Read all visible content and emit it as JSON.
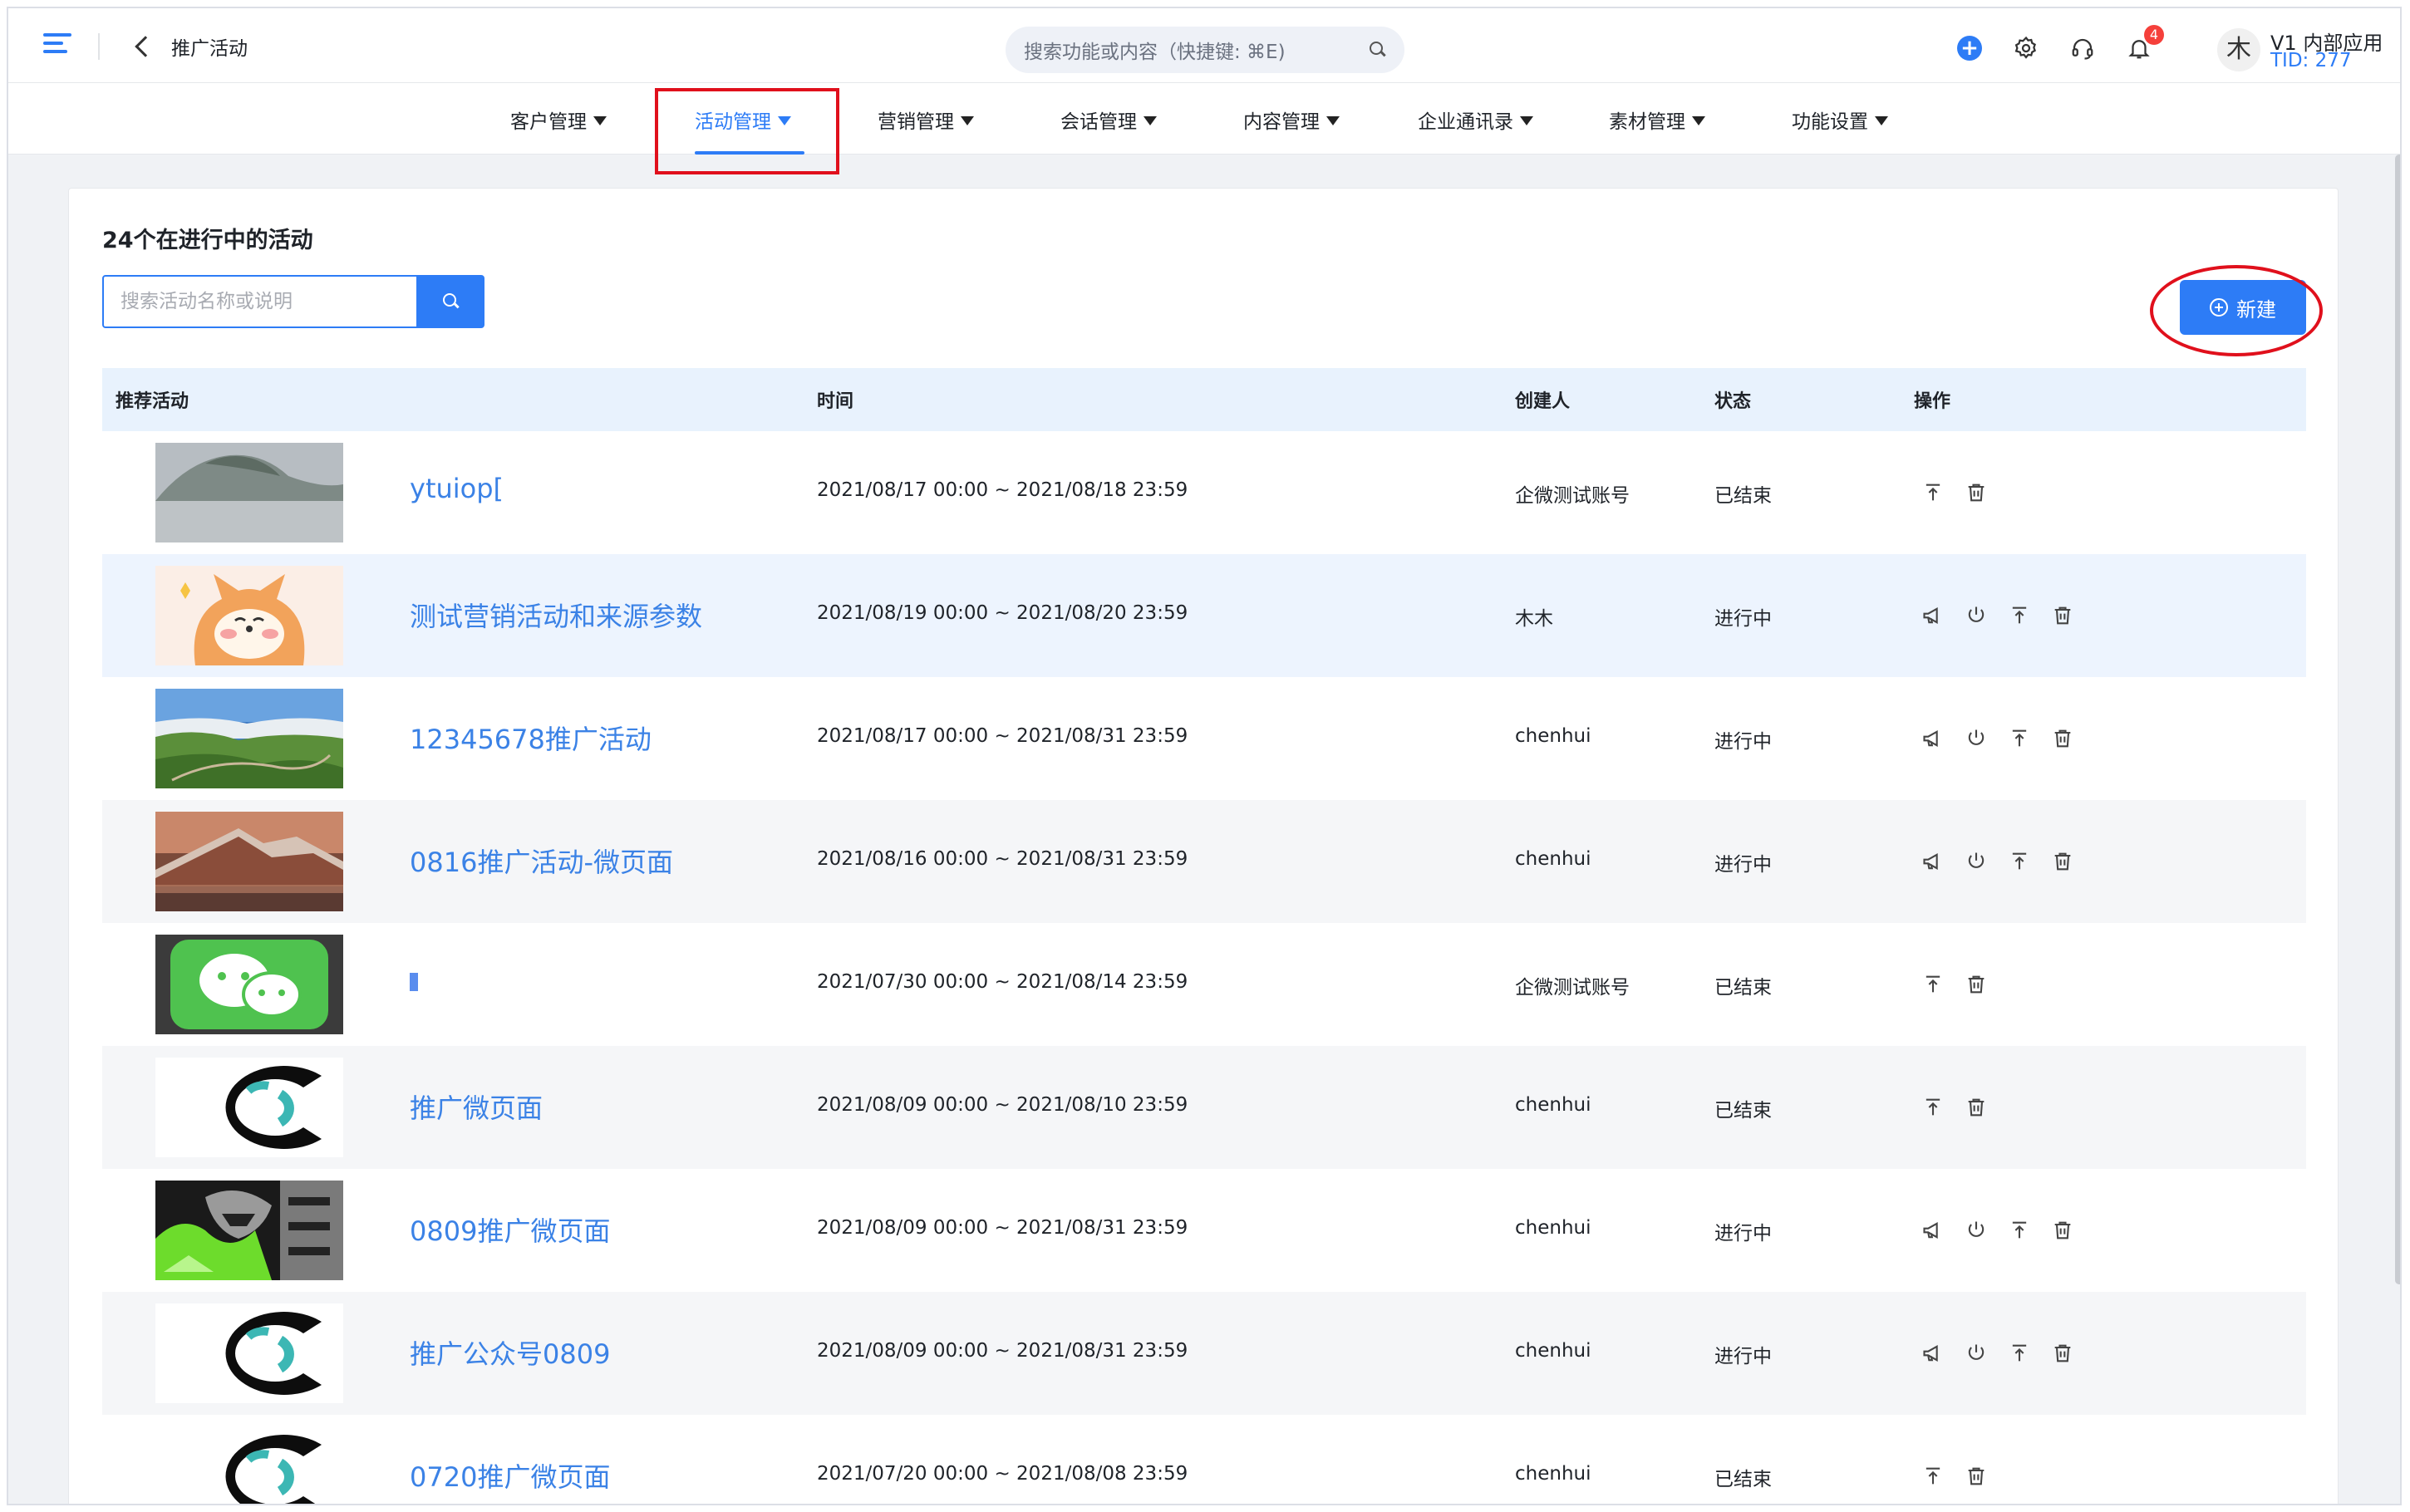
{
  "header": {
    "title": "推广活动",
    "search_placeholder": "搜索功能或内容（快捷键: ⌘E)",
    "notification_count": "4",
    "avatar_text": "木",
    "tenant_name": "V1 内部应用",
    "tenant_tid": "TID: 277"
  },
  "nav": {
    "items": [
      {
        "label": "客户管理"
      },
      {
        "label": "活动管理",
        "active": true
      },
      {
        "label": "营销管理"
      },
      {
        "label": "会话管理"
      },
      {
        "label": "内容管理"
      },
      {
        "label": "企业通讯录"
      },
      {
        "label": "素材管理"
      },
      {
        "label": "功能设置"
      }
    ]
  },
  "main": {
    "heading": "24个在进行中的活动",
    "search_placeholder": "搜索活动名称或说明",
    "new_button_label": "新建",
    "columns": [
      "推荐活动",
      "时间",
      "创建人",
      "状态",
      "操作"
    ],
    "rows": [
      {
        "name": "ytuiop[",
        "time": "2021/08/17 00:00 ~ 2021/08/18 23:59",
        "creator": "企微测试账号",
        "status": "已结束",
        "thumb": "mountain-fog"
      },
      {
        "name": "测试营销活动和来源参数",
        "time": "2021/08/19 00:00 ~ 2021/08/20 23:59",
        "creator": "木木",
        "status": "进行中",
        "thumb": "shiba-cartoon"
      },
      {
        "name": "12345678推广活动",
        "time": "2021/08/17 00:00 ~ 2021/08/31 23:59",
        "creator": "chenhui",
        "status": "进行中",
        "thumb": "green-valley"
      },
      {
        "name": "0816推广活动-微页面",
        "time": "2021/08/16 00:00 ~ 2021/08/31 23:59",
        "creator": "chenhui",
        "status": "进行中",
        "thumb": "sunset-peak"
      },
      {
        "name": "",
        "time": "2021/07/30 00:00 ~ 2021/08/14 23:59",
        "creator": "企微测试账号",
        "status": "已结束",
        "thumb": "wechat-logo"
      },
      {
        "name": "推广微页面",
        "time": "2021/08/09 00:00 ~ 2021/08/10 23:59",
        "creator": "chenhui",
        "status": "已结束",
        "thumb": "c-logo"
      },
      {
        "name": "0809推广微页面",
        "time": "2021/08/09 00:00 ~ 2021/08/31 23:59",
        "creator": "chenhui",
        "status": "进行中",
        "thumb": "green-art"
      },
      {
        "name": "推广公众号0809",
        "time": "2021/08/09 00:00 ~ 2021/08/31 23:59",
        "creator": "chenhui",
        "status": "进行中",
        "thumb": "c-logo"
      },
      {
        "name": "0720推广微页面",
        "time": "2021/07/20 00:00 ~ 2021/08/08 23:59",
        "creator": "chenhui",
        "status": "已结束",
        "thumb": "c-logo"
      }
    ]
  },
  "colors": {
    "accent": "#2d7cf6",
    "link": "#3b82e6",
    "annotation_red": "#e0101c",
    "header_row_bg": "#e8f2fd"
  },
  "icons": {
    "ongoing_ops": [
      "megaphone-icon",
      "power-icon",
      "pin-top-icon",
      "trash-icon"
    ],
    "ended_ops": [
      "pin-top-icon",
      "trash-icon"
    ]
  }
}
